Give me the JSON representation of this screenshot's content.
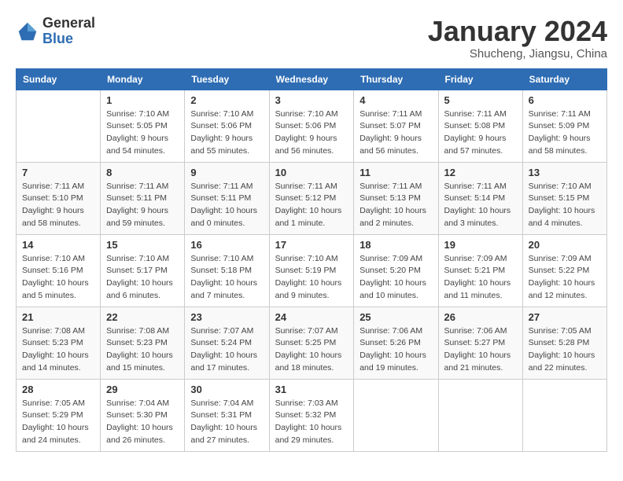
{
  "header": {
    "logo_general": "General",
    "logo_blue": "Blue",
    "month_title": "January 2024",
    "subtitle": "Shucheng, Jiangsu, China"
  },
  "columns": [
    "Sunday",
    "Monday",
    "Tuesday",
    "Wednesday",
    "Thursday",
    "Friday",
    "Saturday"
  ],
  "weeks": [
    [
      {
        "day": "",
        "info": ""
      },
      {
        "day": "1",
        "info": "Sunrise: 7:10 AM\nSunset: 5:05 PM\nDaylight: 9 hours\nand 54 minutes."
      },
      {
        "day": "2",
        "info": "Sunrise: 7:10 AM\nSunset: 5:06 PM\nDaylight: 9 hours\nand 55 minutes."
      },
      {
        "day": "3",
        "info": "Sunrise: 7:10 AM\nSunset: 5:06 PM\nDaylight: 9 hours\nand 56 minutes."
      },
      {
        "day": "4",
        "info": "Sunrise: 7:11 AM\nSunset: 5:07 PM\nDaylight: 9 hours\nand 56 minutes."
      },
      {
        "day": "5",
        "info": "Sunrise: 7:11 AM\nSunset: 5:08 PM\nDaylight: 9 hours\nand 57 minutes."
      },
      {
        "day": "6",
        "info": "Sunrise: 7:11 AM\nSunset: 5:09 PM\nDaylight: 9 hours\nand 58 minutes."
      }
    ],
    [
      {
        "day": "7",
        "info": "Sunrise: 7:11 AM\nSunset: 5:10 PM\nDaylight: 9 hours\nand 58 minutes."
      },
      {
        "day": "8",
        "info": "Sunrise: 7:11 AM\nSunset: 5:11 PM\nDaylight: 9 hours\nand 59 minutes."
      },
      {
        "day": "9",
        "info": "Sunrise: 7:11 AM\nSunset: 5:11 PM\nDaylight: 10 hours\nand 0 minutes."
      },
      {
        "day": "10",
        "info": "Sunrise: 7:11 AM\nSunset: 5:12 PM\nDaylight: 10 hours\nand 1 minute."
      },
      {
        "day": "11",
        "info": "Sunrise: 7:11 AM\nSunset: 5:13 PM\nDaylight: 10 hours\nand 2 minutes."
      },
      {
        "day": "12",
        "info": "Sunrise: 7:11 AM\nSunset: 5:14 PM\nDaylight: 10 hours\nand 3 minutes."
      },
      {
        "day": "13",
        "info": "Sunrise: 7:10 AM\nSunset: 5:15 PM\nDaylight: 10 hours\nand 4 minutes."
      }
    ],
    [
      {
        "day": "14",
        "info": "Sunrise: 7:10 AM\nSunset: 5:16 PM\nDaylight: 10 hours\nand 5 minutes."
      },
      {
        "day": "15",
        "info": "Sunrise: 7:10 AM\nSunset: 5:17 PM\nDaylight: 10 hours\nand 6 minutes."
      },
      {
        "day": "16",
        "info": "Sunrise: 7:10 AM\nSunset: 5:18 PM\nDaylight: 10 hours\nand 7 minutes."
      },
      {
        "day": "17",
        "info": "Sunrise: 7:10 AM\nSunset: 5:19 PM\nDaylight: 10 hours\nand 9 minutes."
      },
      {
        "day": "18",
        "info": "Sunrise: 7:09 AM\nSunset: 5:20 PM\nDaylight: 10 hours\nand 10 minutes."
      },
      {
        "day": "19",
        "info": "Sunrise: 7:09 AM\nSunset: 5:21 PM\nDaylight: 10 hours\nand 11 minutes."
      },
      {
        "day": "20",
        "info": "Sunrise: 7:09 AM\nSunset: 5:22 PM\nDaylight: 10 hours\nand 12 minutes."
      }
    ],
    [
      {
        "day": "21",
        "info": "Sunrise: 7:08 AM\nSunset: 5:23 PM\nDaylight: 10 hours\nand 14 minutes."
      },
      {
        "day": "22",
        "info": "Sunrise: 7:08 AM\nSunset: 5:23 PM\nDaylight: 10 hours\nand 15 minutes."
      },
      {
        "day": "23",
        "info": "Sunrise: 7:07 AM\nSunset: 5:24 PM\nDaylight: 10 hours\nand 17 minutes."
      },
      {
        "day": "24",
        "info": "Sunrise: 7:07 AM\nSunset: 5:25 PM\nDaylight: 10 hours\nand 18 minutes."
      },
      {
        "day": "25",
        "info": "Sunrise: 7:06 AM\nSunset: 5:26 PM\nDaylight: 10 hours\nand 19 minutes."
      },
      {
        "day": "26",
        "info": "Sunrise: 7:06 AM\nSunset: 5:27 PM\nDaylight: 10 hours\nand 21 minutes."
      },
      {
        "day": "27",
        "info": "Sunrise: 7:05 AM\nSunset: 5:28 PM\nDaylight: 10 hours\nand 22 minutes."
      }
    ],
    [
      {
        "day": "28",
        "info": "Sunrise: 7:05 AM\nSunset: 5:29 PM\nDaylight: 10 hours\nand 24 minutes."
      },
      {
        "day": "29",
        "info": "Sunrise: 7:04 AM\nSunset: 5:30 PM\nDaylight: 10 hours\nand 26 minutes."
      },
      {
        "day": "30",
        "info": "Sunrise: 7:04 AM\nSunset: 5:31 PM\nDaylight: 10 hours\nand 27 minutes."
      },
      {
        "day": "31",
        "info": "Sunrise: 7:03 AM\nSunset: 5:32 PM\nDaylight: 10 hours\nand 29 minutes."
      },
      {
        "day": "",
        "info": ""
      },
      {
        "day": "",
        "info": ""
      },
      {
        "day": "",
        "info": ""
      }
    ]
  ]
}
